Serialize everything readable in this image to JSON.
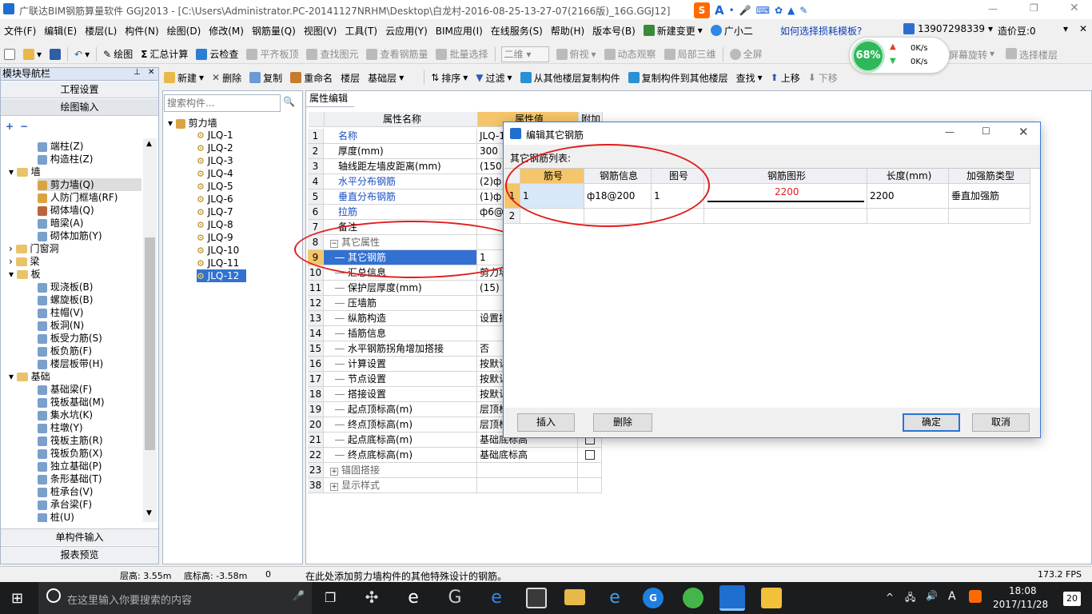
{
  "window": {
    "title": "广联达BIM钢筋算量软件 GGJ2013 - [C:\\Users\\Administrator.PC-20141127NRHM\\Desktop\\白龙村-2016-08-25-13-27-07(2166版)_16G.GGJ12]"
  },
  "menu": [
    "文件(F)",
    "编辑(E)",
    "楼层(L)",
    "构件(N)",
    "绘图(D)",
    "修改(M)",
    "钢筋量(Q)",
    "视图(V)",
    "工具(T)",
    "云应用(Y)",
    "BIM应用(I)",
    "在线服务(S)",
    "帮助(H)",
    "版本号(B)",
    "新建变更",
    "广小二"
  ],
  "menu_right": {
    "help_link": "如何选择损耗模板?",
    "phone": "13907298339",
    "price_bean": "造价豆:0"
  },
  "toolbar1": {
    "draw": "绘图",
    "summary": "汇总计算",
    "cloud_check": "云检查",
    "level_top": "平齐板顶",
    "find_elem": "查找图元",
    "view_rebar": "查看钢筋量",
    "batch_select": "批量选择",
    "view_mode": "二维",
    "top_view": "俯视",
    "dynamic": "动态观察",
    "local_3d": "局部三维",
    "fullscreen": "全屏",
    "screen_rotate": "屏幕旋转",
    "select_floor": "选择楼层"
  },
  "perf": {
    "percent": "68%",
    "up": "0K/s",
    "down": "0K/s"
  },
  "toolbar2": {
    "new": "新建",
    "delete": "删除",
    "copy": "复制",
    "rename": "重命名",
    "floor_label": "楼层",
    "floor_value": "基础层",
    "sort": "排序",
    "filter": "过滤",
    "copy_from": "从其他楼层复制构件",
    "copy_to": "复制构件到其他楼层",
    "find": "查找",
    "move_up": "上移",
    "move_down": "下移"
  },
  "nav": {
    "title": "模块导航栏",
    "project_settings": "工程设置",
    "draw_input": "绘图输入",
    "single_input": "单构件输入",
    "report": "报表预览",
    "items": [
      {
        "label": "端柱(Z)",
        "level": 2
      },
      {
        "label": "构造柱(Z)",
        "level": 2
      },
      {
        "label": "墙",
        "level": 1,
        "folder": true,
        "open": true
      },
      {
        "label": "剪力墙(Q)",
        "level": 2,
        "selected": true
      },
      {
        "label": "人防门框墙(RF)",
        "level": 2
      },
      {
        "label": "砌体墙(Q)",
        "level": 2
      },
      {
        "label": "暗梁(A)",
        "level": 2
      },
      {
        "label": "砌体加筋(Y)",
        "level": 2
      },
      {
        "label": "门窗洞",
        "level": 1,
        "folder": true
      },
      {
        "label": "梁",
        "level": 1,
        "folder": true
      },
      {
        "label": "板",
        "level": 1,
        "folder": true,
        "open": true
      },
      {
        "label": "现浇板(B)",
        "level": 2
      },
      {
        "label": "螺旋板(B)",
        "level": 2
      },
      {
        "label": "柱帽(V)",
        "level": 2
      },
      {
        "label": "板洞(N)",
        "level": 2
      },
      {
        "label": "板受力筋(S)",
        "level": 2
      },
      {
        "label": "板负筋(F)",
        "level": 2
      },
      {
        "label": "楼层板带(H)",
        "level": 2
      },
      {
        "label": "基础",
        "level": 1,
        "folder": true,
        "open": true
      },
      {
        "label": "基础梁(F)",
        "level": 2
      },
      {
        "label": "筏板基础(M)",
        "level": 2
      },
      {
        "label": "集水坑(K)",
        "level": 2
      },
      {
        "label": "柱墩(Y)",
        "level": 2
      },
      {
        "label": "筏板主筋(R)",
        "level": 2
      },
      {
        "label": "筏板负筋(X)",
        "level": 2
      },
      {
        "label": "独立基础(P)",
        "level": 2
      },
      {
        "label": "条形基础(T)",
        "level": 2
      },
      {
        "label": "桩承台(V)",
        "level": 2
      },
      {
        "label": "承台梁(F)",
        "level": 2
      },
      {
        "label": "桩(U)",
        "level": 2
      }
    ]
  },
  "component": {
    "search_placeholder": "搜索构件...",
    "root": "剪力墙",
    "items": [
      "JLQ-1",
      "JLQ-2",
      "JLQ-3",
      "JLQ-4",
      "JLQ-5",
      "JLQ-6",
      "JLQ-7",
      "JLQ-8",
      "JLQ-9",
      "JLQ-10",
      "JLQ-11",
      "JLQ-12"
    ],
    "selected": "JLQ-12"
  },
  "props": {
    "tab": "属性编辑",
    "col_name": "属性名称",
    "col_value": "属性值",
    "col_extra": "附加",
    "rows": [
      {
        "n": "1",
        "name": "名称",
        "value": "JLQ-1",
        "blue": true
      },
      {
        "n": "2",
        "name": "厚度(mm)",
        "value": "300"
      },
      {
        "n": "3",
        "name": "轴线距左墙皮距离(mm)",
        "value": "(150)"
      },
      {
        "n": "4",
        "name": "水平分布钢筋",
        "value": "(2)ф",
        "blue": true
      },
      {
        "n": "5",
        "name": "垂直分布钢筋",
        "value": "(1)ф",
        "blue": true
      },
      {
        "n": "6",
        "name": "拉筋",
        "value": "ф6@6",
        "blue": true
      },
      {
        "n": "7",
        "name": "备注",
        "value": ""
      },
      {
        "n": "8",
        "name": "其它属性",
        "value": "",
        "group": true
      },
      {
        "n": "9",
        "name": "其它钢筋",
        "value": "1",
        "sub": true,
        "selected": true
      },
      {
        "n": "10",
        "name": "汇总信息",
        "value": "剪力墙",
        "sub": true
      },
      {
        "n": "11",
        "name": "保护层厚度(mm)",
        "value": "(15)",
        "sub": true
      },
      {
        "n": "12",
        "name": "压墙筋",
        "value": "",
        "sub": true
      },
      {
        "n": "13",
        "name": "纵筋构造",
        "value": "设置插",
        "sub": true
      },
      {
        "n": "14",
        "name": "插筋信息",
        "value": "",
        "sub": true
      },
      {
        "n": "15",
        "name": "水平钢筋拐角增加搭接",
        "value": "否",
        "sub": true
      },
      {
        "n": "16",
        "name": "计算设置",
        "value": "按默认",
        "sub": true
      },
      {
        "n": "17",
        "name": "节点设置",
        "value": "按默认",
        "sub": true
      },
      {
        "n": "18",
        "name": "搭接设置",
        "value": "按默认",
        "sub": true
      },
      {
        "n": "19",
        "name": "起点顶标高(m)",
        "value": "层顶标",
        "sub": true
      },
      {
        "n": "20",
        "name": "终点顶标高(m)",
        "value": "层顶标",
        "sub": true
      },
      {
        "n": "21",
        "name": "起点底标高(m)",
        "value": "基础底标高",
        "sub": true,
        "check": true
      },
      {
        "n": "22",
        "name": "终点底标高(m)",
        "value": "基础底标高",
        "sub": true,
        "check": true
      },
      {
        "n": "23",
        "name": "锚固搭接",
        "value": "",
        "group": true,
        "collapsed": true
      },
      {
        "n": "38",
        "name": "显示样式",
        "value": "",
        "group": true,
        "collapsed": true
      }
    ]
  },
  "dialog": {
    "title": "编辑其它钢筋",
    "list_label": "其它钢筋列表:",
    "headers": [
      "筋号",
      "钢筋信息",
      "图号",
      "钢筋图形",
      "长度(mm)",
      "加强筋类型"
    ],
    "rows": [
      {
        "n": "1",
        "bar_no": "1",
        "info": "ф18@200",
        "fig": "1",
        "shape_len": "2200",
        "length": "2200",
        "type": "垂直加强筋"
      },
      {
        "n": "2",
        "bar_no": "",
        "info": "",
        "fig": "",
        "shape_len": "",
        "length": "",
        "type": ""
      }
    ],
    "insert": "插入",
    "delete": "删除",
    "ok": "确定",
    "cancel": "取消"
  },
  "status": {
    "floor_h": "层高: 3.55m",
    "bottom_h": "底标高: -3.58m",
    "zero": "0",
    "hint": "在此处添加剪力墙构件的其他特殊设计的钢筋。",
    "fps": "173.2 FPS"
  },
  "taskbar": {
    "search": "在这里输入你要搜索的内容",
    "time": "18:08",
    "date": "2017/11/28",
    "ime": "A",
    "notif": "20"
  }
}
